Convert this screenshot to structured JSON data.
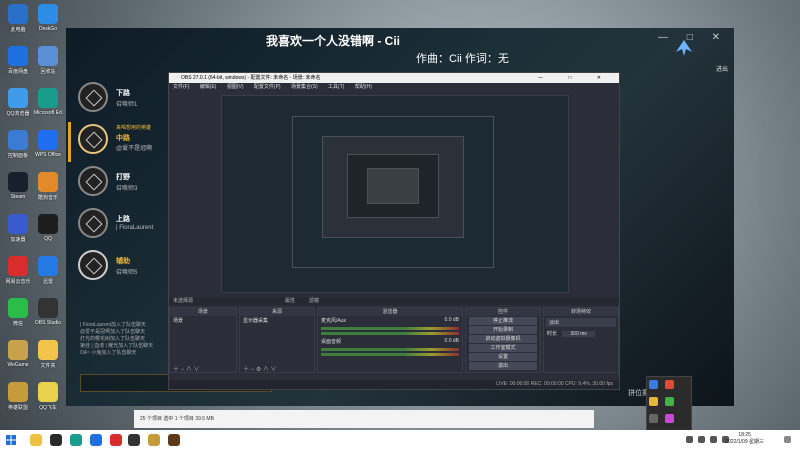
{
  "desktop": {
    "icons": [
      {
        "label": "此电脑",
        "color": "#2a6fc9"
      },
      {
        "label": "DeskGo",
        "color": "#2d8ce3"
      },
      {
        "label": "百度网盘",
        "color": "#1e6fe0"
      },
      {
        "label": "回收站",
        "color": "#5b8fd6"
      },
      {
        "label": "QQ浏览器",
        "color": "#3f9ae8"
      },
      {
        "label": "Microsoft Edge",
        "color": "#1a9c8c"
      },
      {
        "label": "控制面板",
        "color": "#3b7bd1"
      },
      {
        "label": "WPS Office",
        "color": "#1f6ef0"
      },
      {
        "label": "Steam",
        "color": "#17202c"
      },
      {
        "label": "酷狗音乐",
        "color": "#e08a2a"
      },
      {
        "label": "加速器",
        "color": "#3a5bd0"
      },
      {
        "label": "QQ",
        "color": "#1d1d1d"
      },
      {
        "label": "网易云音乐",
        "color": "#d92d2d"
      },
      {
        "label": "迅雷",
        "color": "#2479e3"
      },
      {
        "label": "微信",
        "color": "#2bbd47"
      },
      {
        "label": "OBS Studio",
        "color": "#333333"
      },
      {
        "label": "WeGame",
        "color": "#c7a24a"
      },
      {
        "label": "文件夹",
        "color": "#f2c44c"
      },
      {
        "label": "英雄联盟",
        "color": "#c69b3c"
      },
      {
        "label": "QQ飞车",
        "color": "#e8d14b"
      }
    ]
  },
  "game": {
    "title": "我喜欢一个人没错啊 - Cii",
    "subtitle": "作曲：Cii 作词：无",
    "side_text": "进出",
    "window_controls": "— □ ✕",
    "roles": [
      {
        "name": "下路",
        "sub": "召唤师1",
        "active": false
      },
      {
        "name": "中路",
        "sub": "@爱不是冠啊",
        "note": "来喝想用的英雄",
        "active": true
      },
      {
        "name": "打野",
        "sub": "召唤师3",
        "active": false
      },
      {
        "name": "上路",
        "sub": "| FioraLaurent",
        "active": false
      },
      {
        "name": "辅助",
        "sub": "召唤师5",
        "active": false
      }
    ],
    "chat": [
      "| FioraLaurent加入了队伍聊天",
      "@爱不是冠啊加入了队伍聊天",
      "灯光的樱花树加入了队伍聊天",
      "第佳 | 血液 | 耀光加入了队伍聊天",
      "OA~ 小兔加入了队伍聊天"
    ],
    "bottom_text": "拼位赛 单排/双"
  },
  "obs": {
    "title": "OBS 27.0.1 (64-bit, windows) - 配置文件: 未命名 - 场景: 未命名",
    "menu": [
      "文件(F)",
      "编辑(E)",
      "视图(V)",
      "配置文件(P)",
      "场景集合(S)",
      "工具(T)",
      "帮助(H)"
    ],
    "toolbar": {
      "properties": "属性",
      "filters": "滤镜"
    },
    "no_source_selected": "未选择源",
    "scenes": {
      "header": "场景",
      "items": [
        "场景"
      ]
    },
    "sources": {
      "header": "来源",
      "items": [
        "显示器采集"
      ]
    },
    "mixer": {
      "header": "混音器",
      "tracks": [
        {
          "name": "麦克风/Aux",
          "db": "0.0 dB"
        },
        {
          "name": "桌面音频",
          "db": "0.0 dB"
        }
      ]
    },
    "transitions": {
      "header": "转场特效",
      "type": "淡出",
      "duration_label": "时长",
      "duration": "300 ms"
    },
    "controls": {
      "header": "控件",
      "buttons": [
        "停止推流",
        "开始录制",
        "启动虚拟摄像机",
        "工作室模式",
        "设置",
        "退出"
      ]
    },
    "status": "LIVE: 00:00:00   REC: 00:00:00   CPU: 9.4%, 30.00 fps"
  },
  "explorer": {
    "status": "25 个项目    选中 1 个项目 39.5 MB"
  },
  "taskbar": {
    "time": "18:25",
    "date": "2022/1/09 星期三"
  }
}
